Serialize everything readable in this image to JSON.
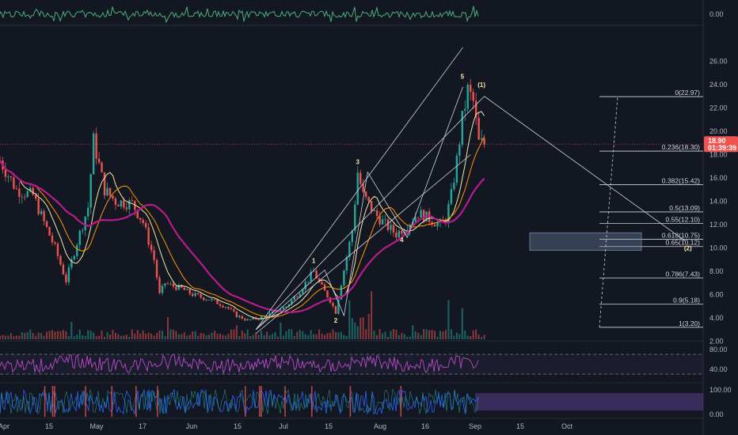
{
  "chart_data": {
    "type": "candlestick",
    "price_axis": {
      "ticks": [
        "26.00",
        "24.00",
        "22.00",
        "20.00",
        "18.00",
        "16.00",
        "14.00",
        "12.00",
        "10.00",
        "8.00",
        "6.00",
        "4.00",
        "2.00"
      ],
      "ylim": [
        1.0,
        27.5
      ]
    },
    "time_axis": {
      "labels": [
        "Apr",
        "15",
        "May",
        "17",
        "Jun",
        "15",
        "Jul",
        "15",
        "Aug",
        "16",
        "Sep",
        "15",
        "Oct"
      ]
    },
    "last_price": {
      "value": "18.90",
      "countdown": "01:39:39"
    },
    "price_path": [
      [
        0,
        17.5
      ],
      [
        3,
        15.0
      ],
      [
        6,
        14.5
      ],
      [
        8,
        12.2
      ],
      [
        10,
        10.0
      ],
      [
        12,
        7.2
      ],
      [
        14,
        10.5
      ],
      [
        16,
        13.5
      ],
      [
        17,
        19.2
      ],
      [
        19,
        15.0
      ],
      [
        21,
        14.0
      ],
      [
        24,
        13.8
      ],
      [
        26,
        12.2
      ],
      [
        28,
        9.0
      ],
      [
        29,
        6.0
      ],
      [
        30,
        7.0
      ],
      [
        31,
        6.8
      ],
      [
        33,
        6.5
      ],
      [
        35,
        6.0
      ],
      [
        38,
        5.6
      ],
      [
        41,
        5.0
      ],
      [
        43,
        4.2
      ],
      [
        45,
        3.8
      ],
      [
        47,
        4.0
      ],
      [
        49,
        4.3
      ],
      [
        52,
        5.0
      ],
      [
        54,
        6.0
      ],
      [
        57,
        8.0
      ],
      [
        58,
        7.0
      ],
      [
        60,
        5.5
      ],
      [
        61,
        4.5
      ],
      [
        62,
        7.0
      ],
      [
        64,
        11.5
      ],
      [
        65,
        16.5
      ],
      [
        66,
        14.5
      ],
      [
        68,
        13.0
      ],
      [
        70,
        12.0
      ],
      [
        72,
        11.2
      ],
      [
        74,
        12.0
      ],
      [
        76,
        13.0
      ],
      [
        78,
        12.5
      ],
      [
        80,
        12.0
      ],
      [
        81,
        12.5
      ],
      [
        82,
        14.5
      ],
      [
        83,
        17.5
      ],
      [
        84,
        21.0
      ],
      [
        85,
        23.5
      ],
      [
        86,
        22.5
      ],
      [
        87,
        19.0
      ],
      [
        88,
        18.9
      ]
    ],
    "elliott_waves": [
      {
        "label": "1",
        "x": 57,
        "y": 8.7
      },
      {
        "label": "2",
        "x": 61,
        "y": 3.6
      },
      {
        "label": "3",
        "x": 65,
        "y": 17.2
      },
      {
        "label": "4",
        "x": 73,
        "y": 10.5
      },
      {
        "label": "5",
        "x": 84,
        "y": 24.5
      },
      {
        "label": "(1)",
        "x": 87.5,
        "y": 23.8
      },
      {
        "label": "(2)",
        "x": 125,
        "y": 9.8
      }
    ],
    "fib_levels": [
      {
        "label": "0(22.97)",
        "value": 22.97
      },
      {
        "label": "0.236(18.30)",
        "value": 18.3
      },
      {
        "label": "0.382(15.42)",
        "value": 15.42
      },
      {
        "label": "0.5(13.09)",
        "value": 13.09
      },
      {
        "label": "0.55(12.10)",
        "value": 12.1
      },
      {
        "label": "0.618(10.75)",
        "value": 10.75
      },
      {
        "label": "0.65(10.12)",
        "value": 10.12
      },
      {
        "label": "0.786(7.43)",
        "value": 7.43
      },
      {
        "label": "0.9(5.18)",
        "value": 5.18
      },
      {
        "label": "1(3.20)",
        "value": 3.2
      }
    ],
    "top_indicator": {
      "value_label": "0.00"
    },
    "rsi_panel": {
      "ticks": [
        "80.00",
        "40.00"
      ]
    },
    "stoch_panel": {
      "ticks": [
        "100.00",
        "0.00"
      ]
    },
    "grid": false
  }
}
